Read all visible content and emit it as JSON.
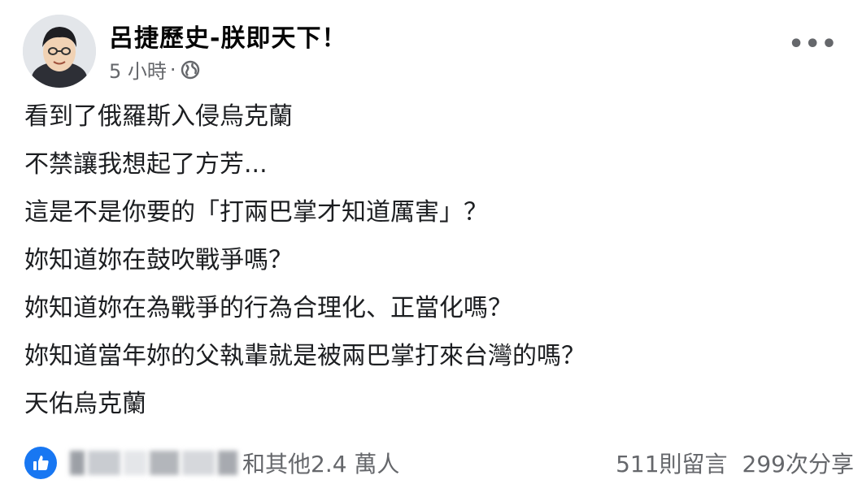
{
  "post": {
    "author": "呂捷歷史-朕即天下！",
    "time": "5 小時",
    "separator": "·",
    "privacy_icon": "globe-icon",
    "more_icon": "more-options-icon",
    "more_label": "•••",
    "lines": [
      "看到了俄羅斯入侵烏克蘭",
      "不禁讓我想起了方芳...",
      "這是不是你要的「打兩巴掌才知道厲害」？",
      "妳知道妳在鼓吹戰爭嗎？",
      "妳知道妳在為戰爭的行為合理化、正當化嗎？",
      "妳知道當年妳的父執輩就是被兩巴掌打來台灣的嗎？",
      "天佑烏克蘭"
    ],
    "reactions": {
      "icon": "like-icon",
      "others_text": "和其他2.4 萬人"
    },
    "comments": "511則留言",
    "shares": "299次分享"
  },
  "colors": {
    "like_blue": "#1877f2",
    "meta_gray": "#65676b"
  }
}
